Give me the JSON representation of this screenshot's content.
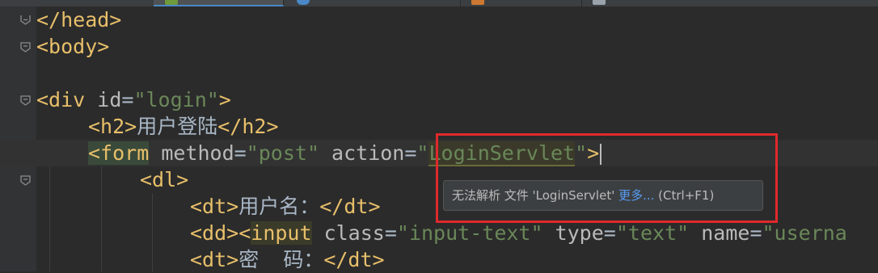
{
  "tabs": [
    {
      "label": "",
      "icon": "file-icon",
      "color": "#6a8759",
      "active": false
    },
    {
      "label": "",
      "icon": "html-file-icon",
      "color": "#6f9a3c",
      "active": true
    },
    {
      "label": "",
      "icon": "web-file-icon",
      "color": "#4a88c7",
      "active": false
    },
    {
      "label": "",
      "icon": "java-file-icon",
      "color": "#cc7832",
      "active": false
    },
    {
      "label": "",
      "icon": "text-file-icon",
      "color": "#9aa3ab",
      "active": false
    }
  ],
  "code": {
    "l1_close_head": "</head>",
    "l2_open_body": "<body>",
    "l4_div_open": "<div",
    "l4_attr": " id",
    "l4_eq": "=",
    "l4_val": "\"login\"",
    "l4_close": ">",
    "l5_h2_open": "<h2>",
    "l5_text": "用户登陆",
    "l5_h2_close": "</h2>",
    "l6_form_open": "<form",
    "l6_attr1": " method",
    "l6_eq1": "=",
    "l6_val1": "\"post\"",
    "l6_attr2": " action",
    "l6_eq2": "=",
    "l6_q1": "\"",
    "l6_action_value": "LoginServlet",
    "l6_q2": "\"",
    "l6_close": ">",
    "l7_dl": "<dl>",
    "l8_dt_open": "<dt>",
    "l8_text": "用户名：",
    "l8_dt_close": "</dt>",
    "l9_dd": "<dd><",
    "l9_input": "input",
    "l9_attr1": " class",
    "l9_eq1": "=",
    "l9_val1": "\"input-text\"",
    "l9_attr2": " type",
    "l9_eq2": "=",
    "l9_val2": "\"text\"",
    "l9_attr3": " name",
    "l9_eq3": "=",
    "l9_val3": "\"userna",
    "l10_dt_open": "<dt>",
    "l10_text": "密  码：",
    "l10_dt_close": "</dt>"
  },
  "tooltip": {
    "message": "无法解析 文件 'LoginServlet' ",
    "more_link": "更多...",
    "shortcut": " (Ctrl+F1)"
  },
  "colors": {
    "background": "#2b2b2b",
    "tag": "#e8bf6a",
    "attribute": "#bababa",
    "string": "#6a8759",
    "highlight_box": "#e0292c",
    "link": "#589df6"
  }
}
